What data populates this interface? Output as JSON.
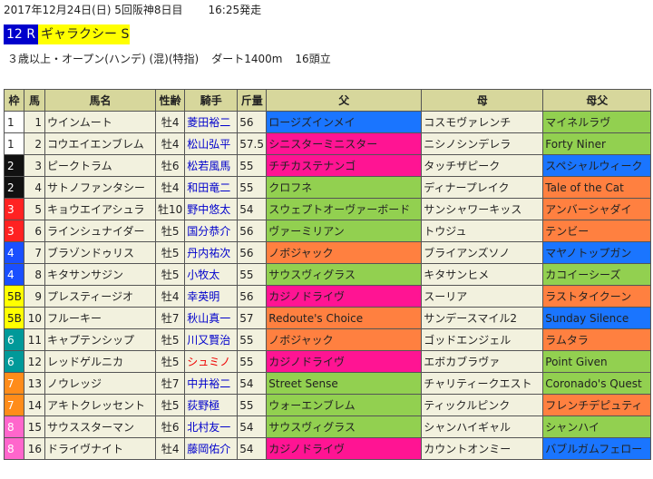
{
  "header": {
    "date_info": "2017年12月24日(日) 5回阪神8日目",
    "post_time": "16:25発走"
  },
  "race": {
    "number": "12 R",
    "name": "ギャラクシー S",
    "conditions": "３歳以上・オープン(ハンデ) (混)(特指)",
    "course": "ダート1400m",
    "runners": "16頭立"
  },
  "table": {
    "headers": [
      "枠",
      "馬",
      "馬名",
      "性齢",
      "騎手",
      "斤量",
      "父",
      "母",
      "母父"
    ],
    "rows": [
      {
        "waku": "1",
        "num": "1",
        "horse": "ウインムート",
        "sexage": "牡4",
        "jockey": "菱田裕二",
        "jockey_red": false,
        "weight": "56",
        "sire": "ロージズインメイ",
        "sire_color": "#1a75ff",
        "dam": "コスモヴァレンチ",
        "damsire": "マイネルラヴ",
        "damsire_color": "#92d050"
      },
      {
        "waku": "1",
        "num": "2",
        "horse": "コウエイエンブレム",
        "sexage": "牡4",
        "jockey": "松山弘平",
        "jockey_red": false,
        "weight": "57.5",
        "sire": "シニスターミニスター",
        "sire_color": "#ff1493",
        "dam": "ニシノシンデレラ",
        "damsire": "Forty Niner",
        "damsire_color": "#92d050"
      },
      {
        "waku": "2",
        "num": "3",
        "horse": "ピークトラム",
        "sexage": "牡6",
        "jockey": "松若風馬",
        "jockey_red": false,
        "weight": "55",
        "sire": "チチカステナンゴ",
        "sire_color": "#ff1493",
        "dam": "タッチザピーク",
        "damsire": "スペシャルウィーク",
        "damsire_color": "#1a75ff"
      },
      {
        "waku": "2",
        "num": "4",
        "horse": "サトノファンタシー",
        "sexage": "牡4",
        "jockey": "和田竜二",
        "jockey_red": false,
        "weight": "55",
        "sire": "クロフネ",
        "sire_color": "#92d050",
        "dam": "ディナープレイク",
        "damsire": "Tale of the Cat",
        "damsire_color": "#ff8040"
      },
      {
        "waku": "3",
        "num": "5",
        "horse": "キョウエイアシュラ",
        "sexage": "牡10",
        "jockey": "野中悠太",
        "jockey_red": false,
        "weight": "54",
        "sire": "スウェプトオーヴァーボード",
        "sire_color": "#92d050",
        "dam": "サンシャワーキッス",
        "damsire": "アンバーシャダイ",
        "damsire_color": "#ff8040"
      },
      {
        "waku": "3",
        "num": "6",
        "horse": "ラインシュナイダー",
        "sexage": "牡5",
        "jockey": "国分恭介",
        "jockey_red": false,
        "weight": "56",
        "sire": "ヴァーミリアン",
        "sire_color": "#92d050",
        "dam": "トウジュ",
        "damsire": "テンビー",
        "damsire_color": "#ff8040"
      },
      {
        "waku": "4",
        "num": "7",
        "horse": "ブラゾンドゥリス",
        "sexage": "牡5",
        "jockey": "丹内祐次",
        "jockey_red": false,
        "weight": "56",
        "sire": "ノボジャック",
        "sire_color": "#ff8040",
        "dam": "ブライアンズソノ",
        "damsire": "マヤノトップガン",
        "damsire_color": "#1a75ff"
      },
      {
        "waku": "4",
        "num": "8",
        "horse": "キタサンサジン",
        "sexage": "牡5",
        "jockey": "小牧太",
        "jockey_red": false,
        "weight": "55",
        "sire": "サウスヴィグラス",
        "sire_color": "#92d050",
        "dam": "キタサンヒメ",
        "damsire": "カコイーシーズ",
        "damsire_color": "#92d050"
      },
      {
        "waku": "5B",
        "num": "9",
        "horse": "プレスティージオ",
        "sexage": "牡4",
        "jockey": "幸英明",
        "jockey_red": false,
        "weight": "56",
        "sire": "カジノドライヴ",
        "sire_color": "#ff1493",
        "dam": "スーリア",
        "damsire": "ラストタイクーン",
        "damsire_color": "#ff8040"
      },
      {
        "waku": "5B",
        "num": "10",
        "horse": "フルーキー",
        "sexage": "牡7",
        "jockey": "秋山真一",
        "jockey_red": false,
        "weight": "57",
        "sire": "Redoute's Choice",
        "sire_color": "#ff8040",
        "dam": "サンデースマイル2",
        "damsire": "Sunday Silence",
        "damsire_color": "#1a75ff"
      },
      {
        "waku": "6",
        "num": "11",
        "horse": "キャプテンシップ",
        "sexage": "牡5",
        "jockey": "川又賢治",
        "jockey_red": false,
        "weight": "55",
        "sire": "ノボジャック",
        "sire_color": "#ff8040",
        "dam": "ゴッドエンジェル",
        "damsire": "ラムタラ",
        "damsire_color": "#ff8040"
      },
      {
        "waku": "6",
        "num": "12",
        "horse": "レッドゲルニカ",
        "sexage": "牡5",
        "jockey": "シュミノ",
        "jockey_red": true,
        "weight": "55",
        "sire": "カジノドライヴ",
        "sire_color": "#ff1493",
        "dam": "エボカブラヴァ",
        "damsire": "Point Given",
        "damsire_color": "#92d050"
      },
      {
        "waku": "7",
        "num": "13",
        "horse": "ノウレッジ",
        "sexage": "牡7",
        "jockey": "中井裕二",
        "jockey_red": false,
        "weight": "54",
        "sire": "Street Sense",
        "sire_color": "#92d050",
        "dam": "チャリティークエスト",
        "damsire": "Coronado's Quest",
        "damsire_color": "#92d050"
      },
      {
        "waku": "7",
        "num": "14",
        "horse": "アキトクレッセント",
        "sexage": "牡5",
        "jockey": "荻野極",
        "jockey_red": false,
        "weight": "55",
        "sire": "ウォーエンブレム",
        "sire_color": "#92d050",
        "dam": "ティックルピンク",
        "damsire": "フレンチデピュティ",
        "damsire_color": "#ff8040"
      },
      {
        "waku": "8",
        "num": "15",
        "horse": "サウススターマン",
        "sexage": "牡6",
        "jockey": "北村友一",
        "jockey_red": false,
        "weight": "54",
        "sire": "サウスヴィグラス",
        "sire_color": "#92d050",
        "dam": "シャンハイギャル",
        "damsire": "シャンハイ",
        "damsire_color": "#92d050"
      },
      {
        "waku": "8",
        "num": "16",
        "horse": "ドライヴナイト",
        "sexage": "牡4",
        "jockey": "藤岡佑介",
        "jockey_red": false,
        "weight": "54",
        "sire": "カジノドライヴ",
        "sire_color": "#ff1493",
        "dam": "カウントオンミー",
        "damsire": "バブルガムフェロー",
        "damsire_color": "#1a75ff"
      }
    ]
  },
  "waku_colors": {
    "1": {
      "bg": "#ffffff",
      "fg": "#222222"
    },
    "2": {
      "bg": "#111111",
      "fg": "#ffffff"
    },
    "3": {
      "bg": "#ff2222",
      "fg": "#ffffff"
    },
    "4": {
      "bg": "#1a4fff",
      "fg": "#ffffff"
    },
    "5B": {
      "bg": "#ffff00",
      "fg": "#222222"
    },
    "6": {
      "bg": "#009999",
      "fg": "#ffffff"
    },
    "7": {
      "bg": "#ff8c1a",
      "fg": "#ffffff"
    },
    "8": {
      "bg": "#ff66cc",
      "fg": "#ffffff"
    }
  }
}
